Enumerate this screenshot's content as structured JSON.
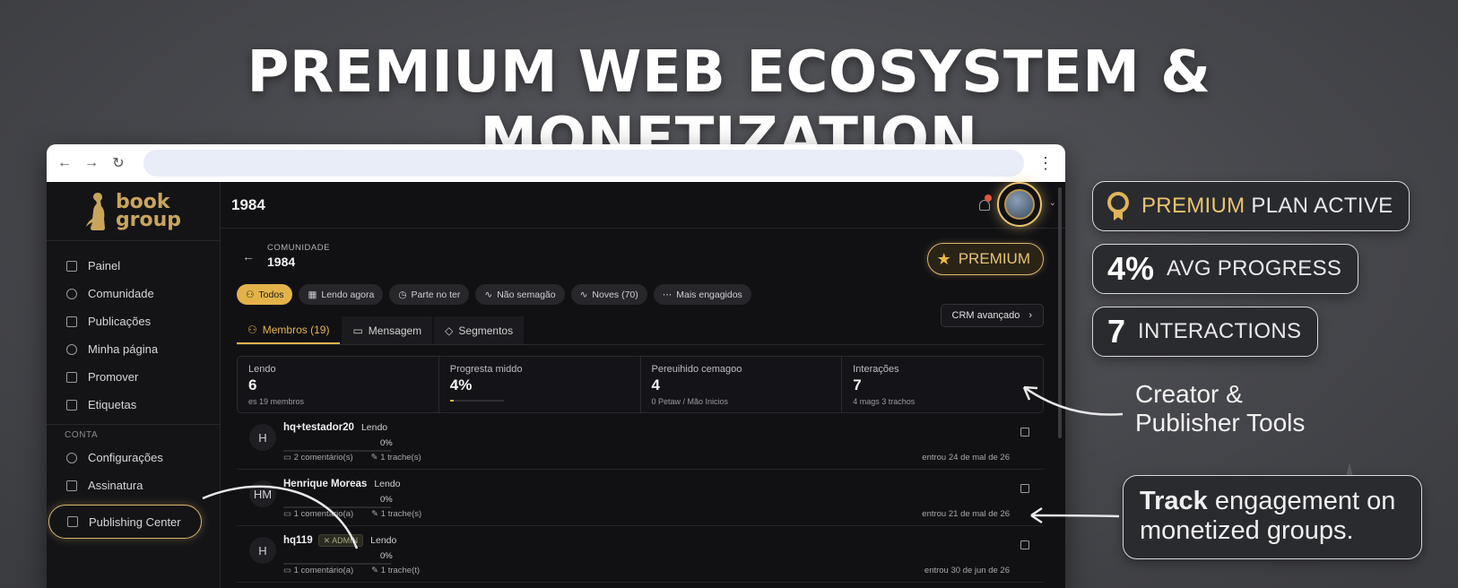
{
  "headline": "PREMIUM WEB ECOSYSTEM & MONETIZATION",
  "browser": {
    "nav_back": "←",
    "nav_forward": "→",
    "nav_reload": "↻",
    "menu": "⋮"
  },
  "sidebar": {
    "logo_text_1": "book",
    "logo_text_2": "group",
    "items": [
      {
        "label": "Painel",
        "icon": "grid-icon"
      },
      {
        "label": "Comunidade",
        "icon": "users-icon"
      },
      {
        "label": "Publicações",
        "icon": "document-icon"
      },
      {
        "label": "Minha página",
        "icon": "globe-icon"
      },
      {
        "label": "Promover",
        "icon": "megaphone-icon"
      },
      {
        "label": "Etiquetas",
        "icon": "tag-icon"
      }
    ],
    "section_label": "CONTA",
    "account_items": [
      {
        "label": "Configurações",
        "icon": "gear-icon"
      },
      {
        "label": "Assinatura",
        "icon": "card-icon"
      },
      {
        "label": "Publishing Center",
        "icon": "book-icon"
      }
    ]
  },
  "topbar": {
    "title": "1984"
  },
  "breadcrumb": {
    "back": "←",
    "section": "COMUNIDADE",
    "name": "1984"
  },
  "premium_badge": {
    "label": "PREMIUM",
    "star": "★"
  },
  "chips": [
    {
      "label": "Todos",
      "active": true
    },
    {
      "label": "Lendo agora",
      "active": false
    },
    {
      "label": "Parte no ter",
      "active": false
    },
    {
      "label": "Não semagão",
      "active": false
    },
    {
      "label": "Noves (70)",
      "active": false
    },
    {
      "label": "Mais engagidos",
      "active": false
    }
  ],
  "crm_button": {
    "label": "CRM avançado",
    "chevron": "›"
  },
  "tabs": [
    {
      "label": "Membros (19)",
      "active": true
    },
    {
      "label": "Mensagem",
      "active": false
    },
    {
      "label": "Segmentos",
      "active": false
    }
  ],
  "stats": [
    {
      "label": "Lendo",
      "value": "6",
      "sub": "es 19 membros"
    },
    {
      "label": "Progresta middo",
      "value": "4%",
      "progress": 0.04
    },
    {
      "label": "Pereuihido cemagoo",
      "value": "4",
      "sub": "0 Petaw / Mão Inicios"
    },
    {
      "label": "Interações",
      "value": "7",
      "sub": "4 mags 3 trachos"
    }
  ],
  "members": [
    {
      "initials": "H",
      "name": "hq+testador20",
      "status": "Lendo",
      "admin": false,
      "progress": "0%",
      "comments": "2 comentário(s)",
      "trechos": "1 trache(s)",
      "joined": "entrou 24 de mal de 26"
    },
    {
      "initials": "HM",
      "name": "Henrique Moreas",
      "status": "Lendo",
      "admin": false,
      "progress": "0%",
      "comments": "1 comentário(a)",
      "trechos": "1 trache(s)",
      "joined": "entrou 21 de mal de 26"
    },
    {
      "initials": "H",
      "name": "hq119",
      "status": "Lendo",
      "admin": true,
      "admin_label": "ADMIN",
      "progress": "0%",
      "comments": "1 comentário(a)",
      "trechos": "1 trache(t)",
      "joined": "entrou 30 de jun de 26"
    }
  ],
  "pills": [
    {
      "big": "",
      "gold": "PREMIUM",
      "word": "PLAN ACTIVE"
    },
    {
      "big": "4%",
      "word": "AVG PROGRESS"
    },
    {
      "big": "7",
      "word": "INTERACTIONS"
    }
  ],
  "callouts": {
    "creator_1": "Creator &",
    "creator_2": "Publisher Tools",
    "track_bold": "Track",
    "track_rest_1": "engagement on",
    "track_rest_2": "monetized groups."
  },
  "colors": {
    "accent": "#e3b34a",
    "background": "#45464b",
    "app_bg": "#111114"
  }
}
